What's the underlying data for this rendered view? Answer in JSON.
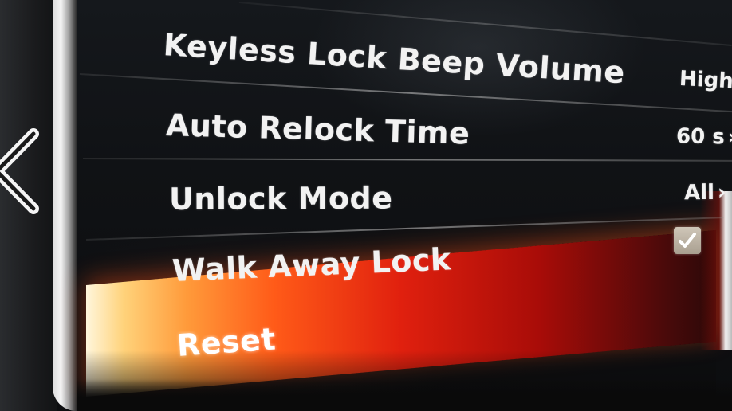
{
  "settings": {
    "items": [
      {
        "label": "Keyless Lock Beep Volume",
        "value": "High",
        "chevron": "›"
      },
      {
        "label": "Auto Relock Time",
        "value": "60 s",
        "chevron": "›"
      },
      {
        "label": "Unlock Mode",
        "value": "All",
        "chevron": "›"
      },
      {
        "label": "Walk Away Lock",
        "checked": true
      },
      {
        "label": "Reset",
        "selected": true
      }
    ]
  },
  "icons": {
    "back": "back-chevron-icon",
    "check": "checkmark-icon"
  },
  "colors": {
    "text": "#f2f2f2",
    "highlight_start": "#ffd27a",
    "highlight_mid": "#e0200e",
    "highlight_end": "#2a0808",
    "checkbox": "#bfb6a8"
  }
}
